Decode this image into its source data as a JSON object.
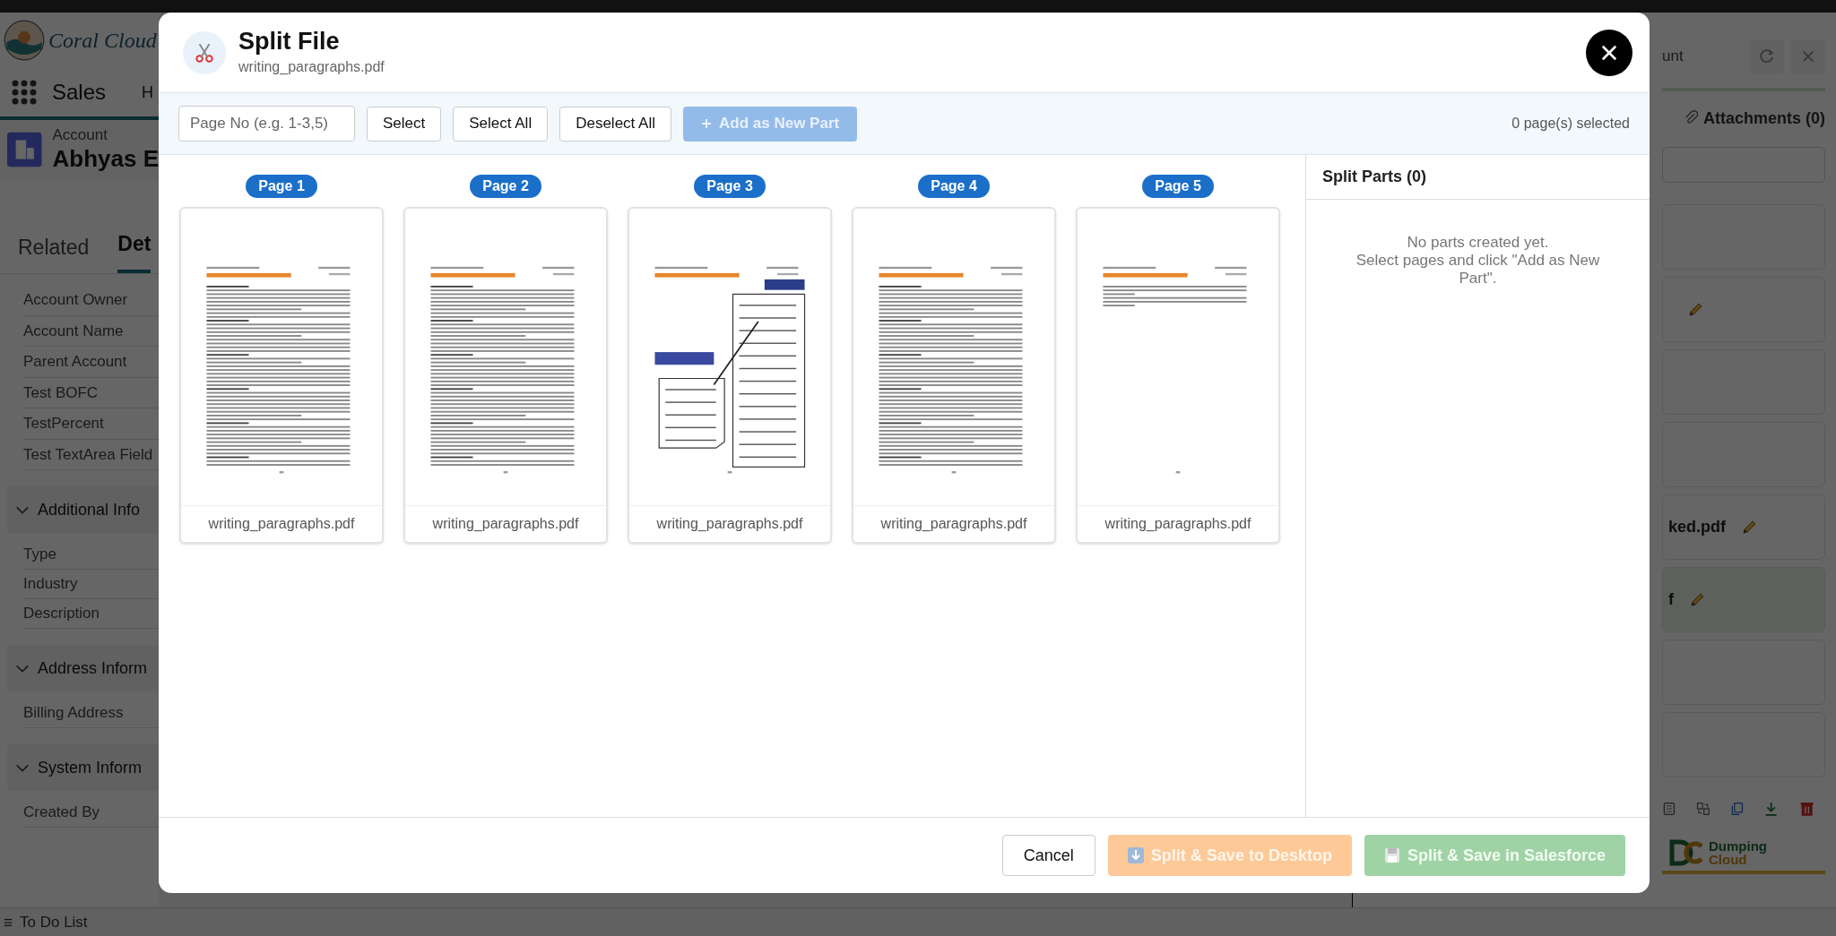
{
  "background": {
    "app_name": "Coral Cloud",
    "nav_app": "Sales",
    "nav_item": "H",
    "record_type": "Account",
    "record_name": "Abhyas E",
    "tabs": [
      {
        "label": "Related",
        "selected": false
      },
      {
        "label": "Det",
        "selected": true
      }
    ],
    "fields": [
      "Account Owner",
      "Account Name",
      "Parent Account",
      "Test BOFC",
      "TestPercent",
      "Test TextArea Field"
    ],
    "sections": [
      {
        "title": "Additional Info",
        "expanded": true,
        "fields": [
          "Type",
          "Industry",
          "Description"
        ]
      },
      {
        "title": "Address Inform",
        "expanded": true,
        "fields": [
          "Billing Address"
        ]
      },
      {
        "title": "System Inform",
        "expanded": true,
        "fields": [
          "Created By"
        ]
      }
    ],
    "utility_bar": "To Do List",
    "side_panel": {
      "title": "unt",
      "attachments_tab": "Attachments (0)",
      "cards": [
        {
          "kind": "blank"
        },
        {
          "kind": "edit"
        },
        {
          "kind": "blank"
        },
        {
          "kind": "blank"
        },
        {
          "kind": "file",
          "name": "ked.pdf",
          "selected": false
        },
        {
          "kind": "file",
          "name": "f",
          "selected": true
        },
        {
          "kind": "blank"
        },
        {
          "kind": "blank"
        }
      ],
      "logo": {
        "line_1": "Dumping",
        "line_2": "Cloud"
      }
    }
  },
  "dialog": {
    "title": "Split File",
    "subtitle": "writing_paragraphs.pdf",
    "toolbar": {
      "page_input": {
        "placeholder": "Page No (e.g. 1-3,5)"
      },
      "buttons": [
        "Select",
        "Select All",
        "Deselect All"
      ],
      "add_button": {
        "label": "Add as New Part",
        "disabled": true
      },
      "selection_count": "0 page(s) selected"
    },
    "pages": [
      {
        "label": "Page 1",
        "file": "writing_paragraphs.pdf",
        "kind": "text",
        "selected": false
      },
      {
        "label": "Page 2",
        "file": "writing_paragraphs.pdf",
        "kind": "text",
        "selected": false
      },
      {
        "label": "Page 3",
        "file": "writing_paragraphs.pdf",
        "kind": "diagram",
        "selected": false
      },
      {
        "label": "Page 4",
        "file": "writing_paragraphs.pdf",
        "kind": "text",
        "selected": false
      },
      {
        "label": "Page 5",
        "file": "writing_paragraphs.pdf",
        "kind": "short",
        "selected": false
      }
    ],
    "parts_panel": {
      "title": "Split Parts (0)",
      "empty_line_1": "No parts created yet.",
      "empty_line_2": "Select pages and click \"Add as New Part\"."
    },
    "footer": {
      "cancel": "Cancel",
      "desktop_button": {
        "label": "Split & Save to Desktop",
        "disabled": true
      },
      "salesforce_button": {
        "label": "Split & Save in Salesforce",
        "disabled": true
      }
    }
  }
}
